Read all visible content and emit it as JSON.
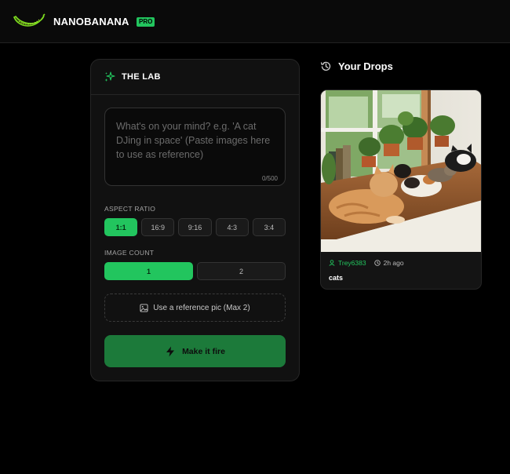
{
  "header": {
    "brand": "NANOBANANA",
    "badge": "PRO",
    "logo_icon": "banana-icon",
    "accent_color": "#22c55e"
  },
  "lab": {
    "title": "THE LAB",
    "title_icon": "sparkles-icon",
    "prompt": {
      "value": "",
      "placeholder": "What's on your mind? e.g. 'A cat DJing in space' (Paste images here to use as reference)",
      "counter": "0/500"
    },
    "aspect_ratio": {
      "label": "ASPECT RATIO",
      "options": [
        "1:1",
        "16:9",
        "9:16",
        "4:3",
        "3:4"
      ],
      "selected": "1:1"
    },
    "image_count": {
      "label": "IMAGE COUNT",
      "options": [
        "1",
        "2"
      ],
      "selected": "1"
    },
    "reference_button": {
      "label": "Use a reference pic (Max 2)",
      "icon": "image-icon"
    },
    "submit_button": {
      "label": "Make it fire",
      "icon": "lightning-icon",
      "color": "#1c7a3a"
    }
  },
  "drops": {
    "title": "Your Drops",
    "title_icon": "history-icon",
    "items": [
      {
        "user": "Trey6383",
        "time": "2h ago",
        "caption": "cats",
        "image_alt": "cats lounging on a windowsill with houseplants"
      }
    ]
  }
}
